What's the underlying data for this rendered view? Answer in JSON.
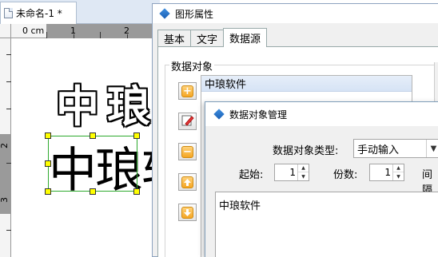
{
  "editor": {
    "doc_tab_label": "未命名-1 *",
    "ruler_unit": "0 cm",
    "ruler_top_labels": [
      "1",
      "2"
    ],
    "ruler_left_labels": [
      "2",
      "3"
    ],
    "outline_text": "中琅",
    "selected_text": "中琅软"
  },
  "props_window": {
    "title": "图形属性",
    "tabs": [
      "基本",
      "文字",
      "数据源"
    ],
    "active_tab": "数据源",
    "group_title": "数据对象",
    "list_items": [
      "中琅软件"
    ],
    "side_buttons": [
      "add-icon",
      "edit-icon",
      "remove-icon",
      "move-up-icon",
      "move-down-icon"
    ]
  },
  "dialog": {
    "title": "数据对象管理",
    "type_label": "数据对象类型:",
    "type_value": "手动输入",
    "start_label": "起始:",
    "start_value": "1",
    "copies_label": "份数:",
    "copies_value": "1",
    "interval_label": "间隔",
    "content": "中琅软件"
  },
  "colors": {
    "accent_orange": "#f5a623",
    "selection_green": "#2eaa2e",
    "handle_yellow": "#ffff00",
    "list_selected": "#d6e3f5"
  }
}
